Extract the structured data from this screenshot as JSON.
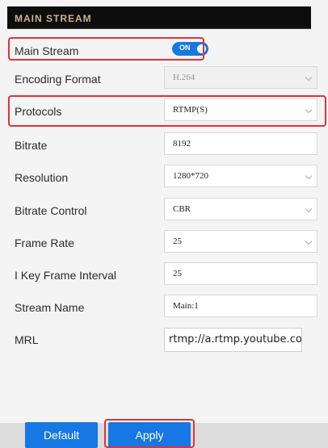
{
  "header": {
    "title": "MAIN STREAM"
  },
  "rows": {
    "main_stream": {
      "label": "Main Stream",
      "toggle_text": "ON"
    },
    "encoding_format": {
      "label": "Encoding Format",
      "value": "H.264"
    },
    "protocols": {
      "label": "Protocols",
      "value": "RTMP(S)"
    },
    "bitrate": {
      "label": "Bitrate",
      "value": "8192"
    },
    "resolution": {
      "label": "Resolution",
      "value": "1280*720"
    },
    "bitrate_control": {
      "label": "Bitrate Control",
      "value": "CBR"
    },
    "frame_rate": {
      "label": "Frame Rate",
      "value": "25"
    },
    "i_key_frame_interval": {
      "label": "I Key Frame Interval",
      "value": "25"
    },
    "stream_name": {
      "label": "Stream Name",
      "value": "Main:1"
    },
    "mrl": {
      "label": "MRL",
      "value": "rtmp://a.rtmp.youtube.com/l"
    }
  },
  "buttons": {
    "default_label": "Default",
    "apply_label": "Apply"
  },
  "colors": {
    "accent": "#1677e5",
    "highlight": "#e0323c",
    "header_bg": "#0d0d0d",
    "header_text": "#c9b28a"
  },
  "icons": {
    "chevron": "chevron-down-icon"
  }
}
